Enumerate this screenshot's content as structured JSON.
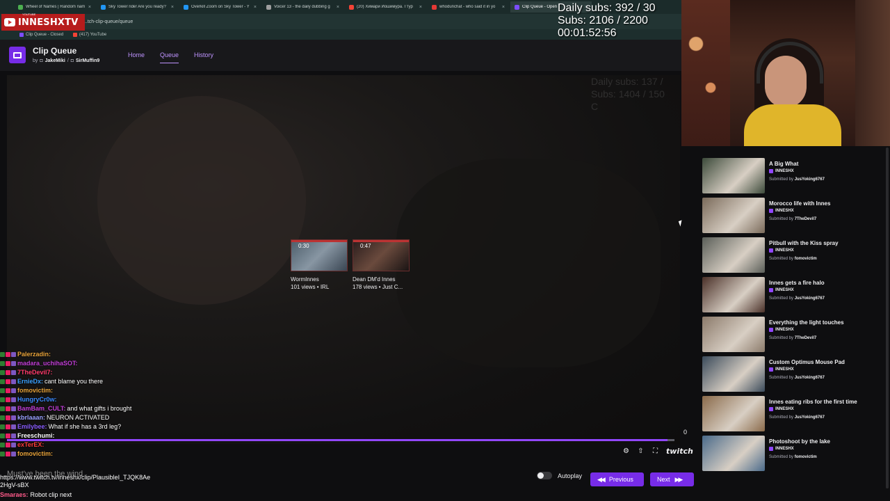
{
  "browser": {
    "tabs": [
      {
        "label": "Wheel of Names | Random nam",
        "color": "#4caf50"
      },
      {
        "label": "Sky Tower ride! Are you ready?",
        "color": "#2196f3"
      },
      {
        "label": "Overkill Zoom on Sky Tower - Y",
        "color": "#2196f3"
      },
      {
        "label": "Voicer 13 - the daily dubbing g",
        "color": "#9e9e9e"
      },
      {
        "label": "(20) Химари Йошимура. Ι тур",
        "color": "#f44336"
      },
      {
        "label": "whodunchat - who said it in yo",
        "color": "#e53935"
      },
      {
        "label": "Clip Queue - Open",
        "color": "#7c4dff"
      }
    ],
    "address": "...tch-clip-queue/queue",
    "bookmarks": [
      "Clip Queue - Closed",
      "(417) YouTube"
    ]
  },
  "channel_logo": {
    "text": "INNESHXTV",
    "small": "YOUTUBE"
  },
  "app": {
    "title": "Clip Queue",
    "by_label": "by",
    "author1": "JakeMiki",
    "separator": "/",
    "author2": "SirMuffin9",
    "nav": [
      "Home",
      "Queue",
      "History"
    ]
  },
  "video": {
    "ghost_text": [
      "Daily subs: 137 /",
      "Subs: 1404 / 150",
      "C"
    ],
    "endscreen": [
      {
        "duration": "0:30",
        "title": "WormInnes",
        "meta": "101 views • IRL"
      },
      {
        "duration": "0:47",
        "title": "Dean DM'd Innes",
        "meta": "178 views • Just C..."
      }
    ],
    "progress_fraction": 0.99,
    "count": "0",
    "brand": "twitch"
  },
  "controls": {
    "autoplay_label": "Autoplay",
    "previous_label": "Previous",
    "next_label": "Next"
  },
  "overlay": {
    "daily_subs": "Daily subs: 392 / 30",
    "subs": "Subs: 2106 / 2200",
    "timer": "00:01:52:56"
  },
  "chat": [
    {
      "name": "Palerzadin:",
      "color": "#e8a33a",
      "msg": ""
    },
    {
      "name": "madara_uchihaSOT:",
      "color": "#c13ed6",
      "msg": ""
    },
    {
      "name": "7TheDevil7:",
      "color": "#ff3b6b",
      "msg": ""
    },
    {
      "name": "ErnieDx:",
      "color": "#3aa1ff",
      "msg": "cant blame you there"
    },
    {
      "name": "fomovictim:",
      "color": "#e8a33a",
      "msg": ""
    },
    {
      "name": "HungryCr0w:",
      "color": "#3a8bff",
      "msg": ""
    },
    {
      "name": "BamBam_CULT:",
      "color": "#c13ed6",
      "msg": "and what gifts i brought"
    },
    {
      "name": "kbrlaaan:",
      "color": "#9aa0ff",
      "msg": "NEURON ACTIVATED"
    },
    {
      "name": "Emilybee:",
      "color": "#8a5cff",
      "msg": "What if she has a 3rd leg?"
    },
    {
      "name": "Freeschumi:",
      "color": "#ffffff",
      "msg": ""
    },
    {
      "name": "exTerEX:",
      "color": "#ff3b3b",
      "msg": ""
    },
    {
      "name": "fomovictim:",
      "color": "#e8a33a",
      "msg": ""
    }
  ],
  "chat_cover_text": "Must've been the wind",
  "chat_url": "https://www.twitch.tv/inneshx/clip/PlausibleI_TJQK8Ae2HgV-sBX",
  "last_chat": {
    "name": "Smaraes:",
    "color": "#ff5a8a",
    "msg": "Robot clip next"
  },
  "queue": [
    {
      "title": "A Big What",
      "channel": "INNESHX",
      "submitted_prefix": "Submitted by",
      "submitter": "JusYoking6767",
      "thumb": "#3c4a3a"
    },
    {
      "title": "Morocco life with Innes",
      "channel": "INNESHX",
      "submitted_prefix": "Submitted by",
      "submitter": "7TheDevil7",
      "thumb": "#7a6a5a"
    },
    {
      "title": "Pitbull with the Kiss spray",
      "channel": "INNESHX",
      "submitted_prefix": "Submitted by",
      "submitter": "fomovictim",
      "thumb": "#5a5e58"
    },
    {
      "title": "Innes gets a fire halo",
      "channel": "INNESHX",
      "submitted_prefix": "Submitted by",
      "submitter": "JusYoking6767",
      "thumb": "#4a3028"
    },
    {
      "title": "Everything the light touches",
      "channel": "INNESHX",
      "submitted_prefix": "Submitted by",
      "submitter": "7TheDevil7",
      "thumb": "#8b7a6a"
    },
    {
      "title": "Custom Optimus Mouse Pad",
      "channel": "INNESHX",
      "submitted_prefix": "Submitted by",
      "submitter": "JusYoking6767",
      "thumb": "#3a4a5a"
    },
    {
      "title": "Innes eating ribs for the first time",
      "channel": "INNESHX",
      "submitted_prefix": "Submitted by",
      "submitter": "JusYoking6767",
      "thumb": "#8a6a4a"
    },
    {
      "title": "Photoshoot by the lake",
      "channel": "INNESHX",
      "submitted_prefix": "Submitted by",
      "submitter": "fomovictim",
      "thumb": "#4a6a8a"
    }
  ]
}
